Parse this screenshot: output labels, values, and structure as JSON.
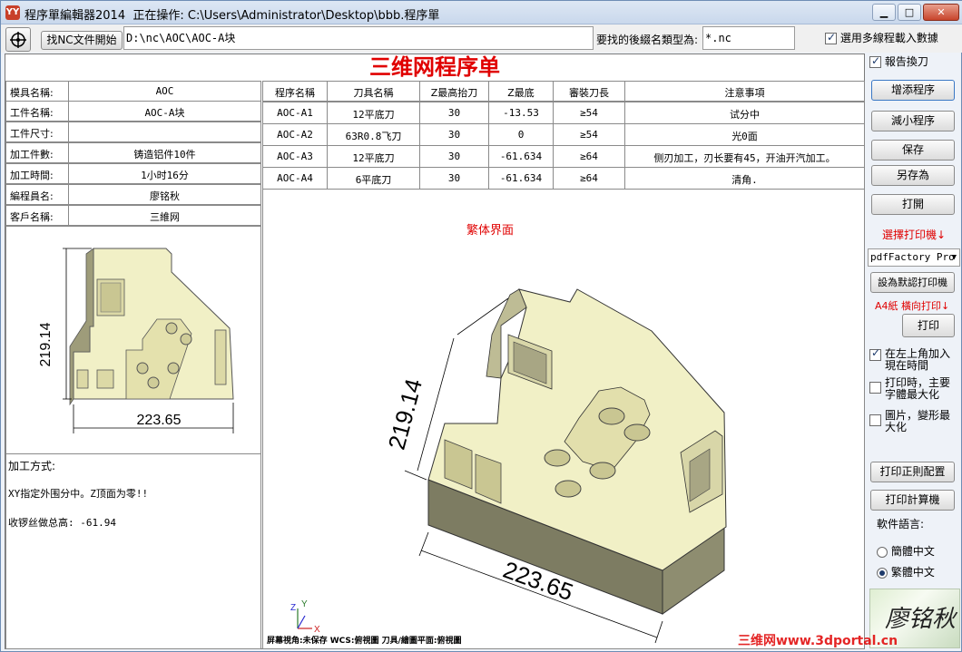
{
  "window": {
    "app_name": "程序單編輯器2014",
    "status_label": "正在操作:",
    "file_path": "C:\\Users\\Administrator\\Desktop\\bbb.程序單",
    "app_icon_glyph": "YY"
  },
  "toolbar": {
    "find_nc_button": "找NC文件開始",
    "nc_path": "D:\\nc\\AOC\\AOC-A块",
    "ext_label": "要找的後綴名類型為:",
    "ext_value": "*.nc",
    "multi_line_label": "選用多線程載入數據",
    "multi_line_checked": true
  },
  "sheet": {
    "title": "三维网程序单",
    "info": [
      {
        "label": "模具名稱:",
        "value": "AOC"
      },
      {
        "label": "工件名稱:",
        "value": "AOC-A块"
      },
      {
        "label": "工件尺寸:",
        "value": ""
      },
      {
        "label": "加工件數:",
        "value": "铸造铝件10件"
      },
      {
        "label": "加工時間:",
        "value": "1小时16分"
      },
      {
        "label": "編程員名:",
        "value": "廖铭秋"
      },
      {
        "label": "客戶名稱:",
        "value": "三維网"
      }
    ],
    "method_label": "加工方式:",
    "method_lines": [
      "XY指定外围分中。Z顶面为零!!",
      "收锣丝做总高: -61.94"
    ],
    "table_headers": [
      "程序名稱",
      "刀具名稱",
      "Z最高抬刀",
      "Z最底",
      "審裝刀長",
      "注意事項"
    ],
    "table_rows": [
      [
        "AOC-A1",
        "12平底刀",
        "30",
        "-13.53",
        "≥54",
        "试分中"
      ],
      [
        "AOC-A2",
        "63R0.8飞刀",
        "30",
        "0",
        "≥54",
        "光0面"
      ],
      [
        "AOC-A3",
        "12平底刀",
        "30",
        "-61.634",
        "≥64",
        "侧刃加工，刃长要有45，开油开汽加工。"
      ],
      [
        "AOC-A4",
        "6平底刀",
        "30",
        "-61.634",
        "≥64",
        "清角."
      ]
    ],
    "view_caption": "繁体界面",
    "dim_w": "223.65",
    "dim_h": "219.14",
    "view_status": "屏幕視角:未保存    WCS:俯視圖    刀具/繪圖平面:俯視圖",
    "axis_z": "Z",
    "axis_y": "Y",
    "axis_x": "X"
  },
  "right_panel": {
    "report_wrap_label": "報告換刀",
    "report_wrap_checked": true,
    "add_btn": "增添程序",
    "remove_btn": "減小程序",
    "save_btn": "保存",
    "save_as_btn": "另存為",
    "open_btn": "打開",
    "select_printer_label": "選擇打印機↓",
    "printer_value": "pdfFactory Pro",
    "default_printer_btn": "設為默認打印機",
    "paper_label": "A4紙  橫向打印↓",
    "print_btn": "打印",
    "opt_time_label": "在左上角加入現在時間",
    "opt_time_checked": true,
    "opt_font_label": "打印時，主要字體最大化",
    "opt_font_checked": false,
    "opt_img_label": "圖片，變形最大化",
    "opt_img_checked": false,
    "print_config_btn": "打印正則配置",
    "print_calc_btn": "打印計算機",
    "lang_label": "軟件語言:",
    "lang_simplified": "簡體中文",
    "lang_traditional": "繁體中文",
    "lang_selected": "traditional",
    "signature": "廖铭秋"
  },
  "watermark": "三维网www.3dportal.cn",
  "colors": {
    "accent_red": "#e00000",
    "part_body": "#f1f0c6",
    "part_side": "#7d7c62"
  }
}
